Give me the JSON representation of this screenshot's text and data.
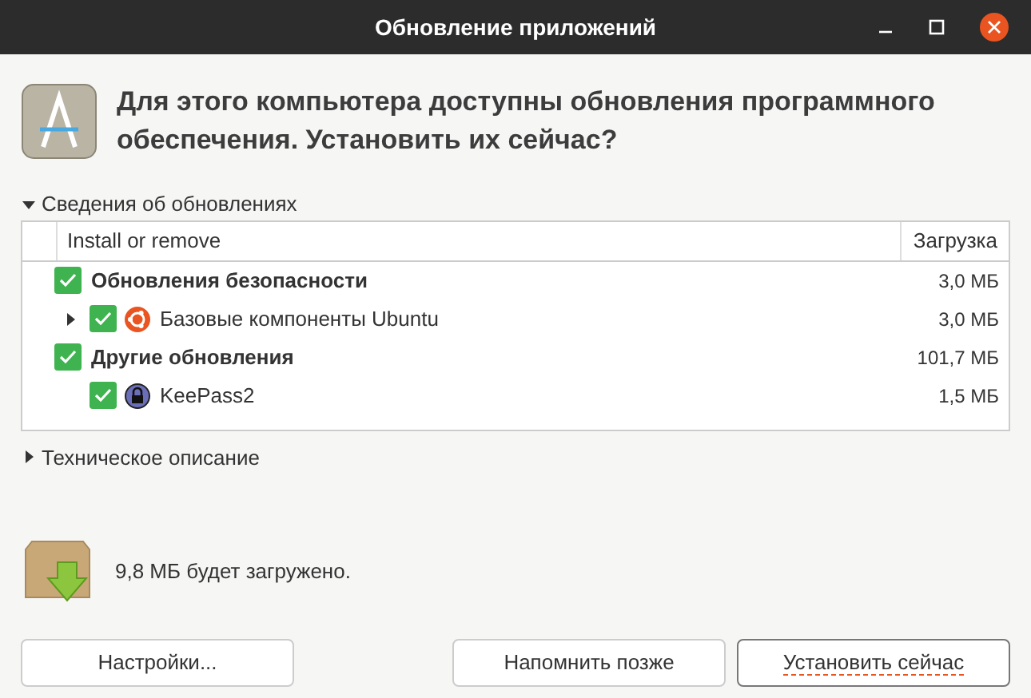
{
  "window": {
    "title": "Обновление приложений"
  },
  "heading": "Для этого компьютера доступны обновления программного обеспечения. Установить их сейчас?",
  "details": {
    "label": "Сведения об обновлениях",
    "expanded": true
  },
  "table": {
    "columns": [
      "Install or remove",
      "Загрузка"
    ],
    "rows": [
      {
        "kind": "group",
        "label": "Обновления безопасности",
        "size": "3,0 МБ",
        "checked": true,
        "children": [
          {
            "kind": "core",
            "label": "Базовые компоненты Ubuntu",
            "size": "3,0 МБ",
            "checked": true,
            "expanded": false
          }
        ]
      },
      {
        "kind": "group",
        "label": "Другие обновления",
        "size": "101,7 МБ",
        "checked": true,
        "children": [
          {
            "kind": "app",
            "label": "KeePass2",
            "size": "1,5 МБ",
            "checked": true
          }
        ]
      }
    ]
  },
  "technical": {
    "label": "Техническое описание",
    "expanded": false
  },
  "download_note": "9,8 МБ будет загружено.",
  "buttons": [
    {
      "label": "Настройки...",
      "default": false
    },
    {
      "label": "Напомнить позже",
      "default": false
    },
    {
      "label": "Установить сейчас",
      "default": true
    }
  ]
}
